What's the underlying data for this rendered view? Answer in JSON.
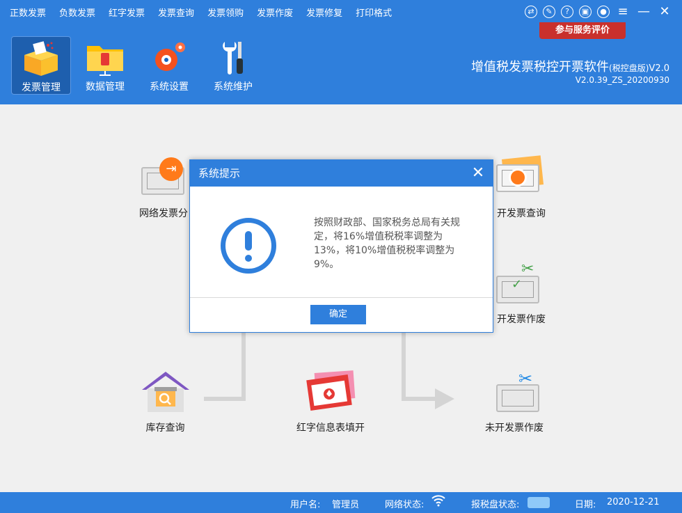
{
  "menu": [
    "正数发票",
    "负数发票",
    "红字发票",
    "发票查询",
    "发票领购",
    "发票作废",
    "发票修复",
    "打印格式"
  ],
  "window_controls": [
    "swap-icon",
    "feedback-icon",
    "help-icon",
    "lock-icon",
    "user-icon",
    "menu-icon",
    "minimize-icon",
    "close-icon"
  ],
  "eval_button": "参与服务评价",
  "toolbar": {
    "invoice_mgmt": "发票管理",
    "data_mgmt": "数据管理",
    "system_settings": "系统设置",
    "system_maintenance": "系统维护"
  },
  "app": {
    "title": "增值税发票税控开票软件",
    "edition": "(税控盘版)",
    "version_suffix": "V2.0",
    "build": "V2.0.39_ZS_20200930"
  },
  "flow": {
    "net_dist": "网络发票分",
    "issued_query": "开发票查询",
    "issued_void": "开发票作废",
    "stock_query": "库存查询",
    "red_info_fill": "红字信息表填开",
    "unissued_void": "未开发票作废"
  },
  "status": {
    "user_label": "用户名:",
    "user_value": "管理员",
    "network_label": "网络状态:",
    "taxdisk_label": "报税盘状态:",
    "date_label": "日期:",
    "date_value": "2020-12-21"
  },
  "dialog": {
    "title": "系统提示",
    "message": "按照财政部、国家税务总局有关规定，将16%增值税税率调整为13%，将10%增值税税率调整为9%。",
    "ok": "确定"
  },
  "colors": {
    "primary": "#2f7fdc",
    "eval": "#c9302c"
  }
}
